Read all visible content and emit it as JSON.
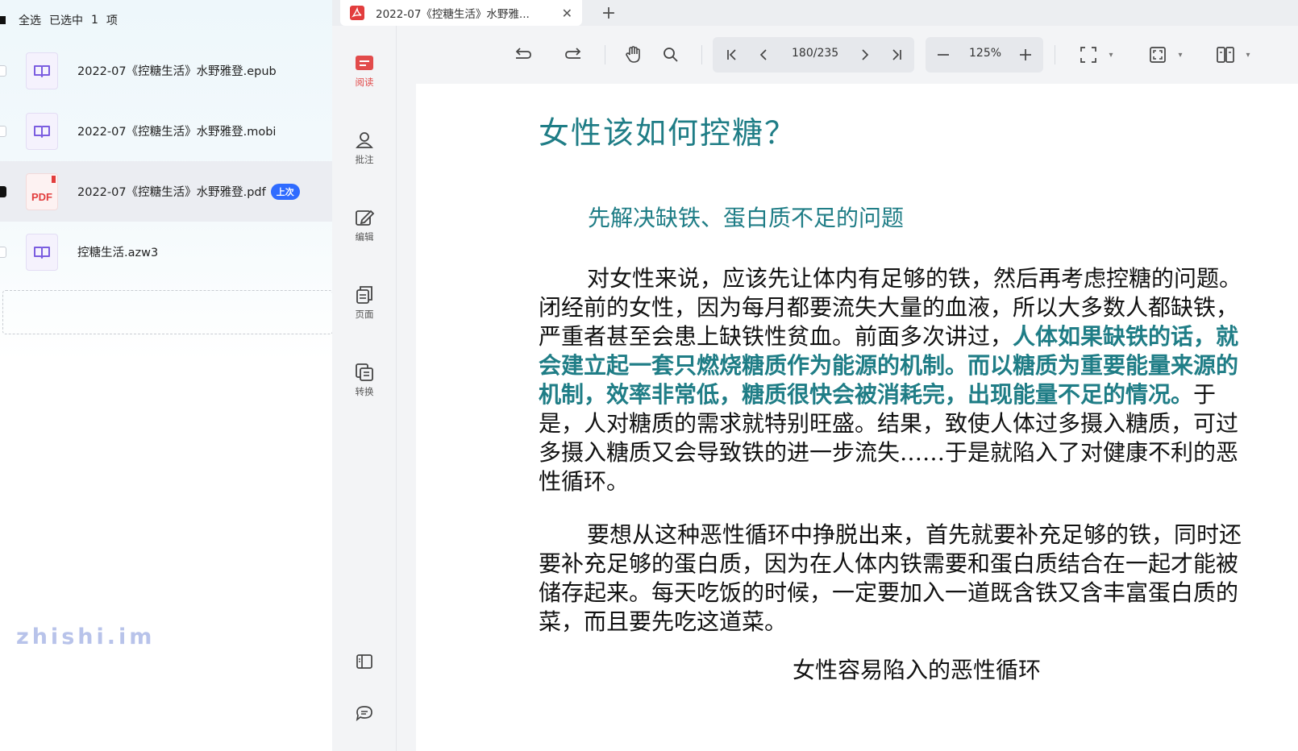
{
  "tab": {
    "title": "2022-07《控糖生活》水野雅...",
    "close": "✕",
    "add": "+"
  },
  "file_panel": {
    "select_all": "全选",
    "selected_prefix": "已选中",
    "selected_count": "1",
    "selected_suffix": "项",
    "files": [
      {
        "name": "2022-07《控糖生活》水野雅登.epub",
        "type": "book",
        "checked": false
      },
      {
        "name": "2022-07《控糖生活》水野雅登.mobi",
        "type": "book",
        "checked": false
      },
      {
        "name": "2022-07《控糖生活》水野雅登.pdf",
        "type": "pdf",
        "checked": true,
        "badge": "上次",
        "icon_text": "PDF"
      },
      {
        "name": "控糖生活.azw3",
        "type": "book",
        "checked": false
      }
    ],
    "watermark": "zhishi.im"
  },
  "tool_rail": {
    "items": [
      {
        "label": "阅读",
        "icon": "read-icon",
        "active": true
      },
      {
        "label": "批注",
        "icon": "annotate-icon",
        "active": false
      },
      {
        "label": "编辑",
        "icon": "edit-icon",
        "active": false
      },
      {
        "label": "页面",
        "icon": "pages-icon",
        "active": false
      },
      {
        "label": "转换",
        "icon": "convert-icon",
        "active": false
      }
    ]
  },
  "toolbar": {
    "page_indicator": "180/235",
    "zoom": "125%"
  },
  "document": {
    "title": "女性该如何控糖？",
    "subtitle": "先解决缺铁、蛋白质不足的问题",
    "para1": [
      [
        {
          "t": "对女性来说，应该先让体内有足够的铁，然后再考虑控糖的问题。"
        }
      ],
      [
        {
          "t": "闭经前的女性，因为每月都要流失大量的血液，所以大多数人都缺铁，"
        }
      ],
      [
        {
          "t": "严重者甚至会患上缺铁性贫血。前面多次讲过，"
        },
        {
          "t": "人体如果缺铁的话，就",
          "hl": true
        }
      ],
      [
        {
          "t": "会建立起一套只燃烧糖质作为能源的机制。而以糖质为重要能量来源的",
          "hl": true
        }
      ],
      [
        {
          "t": "机制，效率非常低，糖质很快会被消耗完，出现能量不足的情况。",
          "hl": true
        },
        {
          "t": "于"
        }
      ],
      [
        {
          "t": "是，人对糖质的需求就特别旺盛。结果，致使人体过多摄入糖质，可过"
        }
      ],
      [
        {
          "t": "多摄入糖质又会导致铁的进一步流失……于是就陷入了对健康不利的恶"
        }
      ],
      [
        {
          "t": "性循环。"
        }
      ]
    ],
    "para2": [
      "要想从这种恶性循环中挣脱出来，首先就要补充足够的铁，同时还",
      "要补充足够的蛋白质，因为在人体内铁需要和蛋白质结合在一起才能被",
      "储存起来。每天吃饭的时候，一定要加入一道既含铁又含丰富蛋白质的",
      "菜，而且要先吃这道菜。"
    ],
    "caption": "女性容易陷入的恶性循环"
  },
  "colors": {
    "accent_teal": "#1f7d86",
    "active_red": "#e24b4b",
    "badge_blue": "#2f6bff",
    "pdf_red": "#e23d3d"
  }
}
